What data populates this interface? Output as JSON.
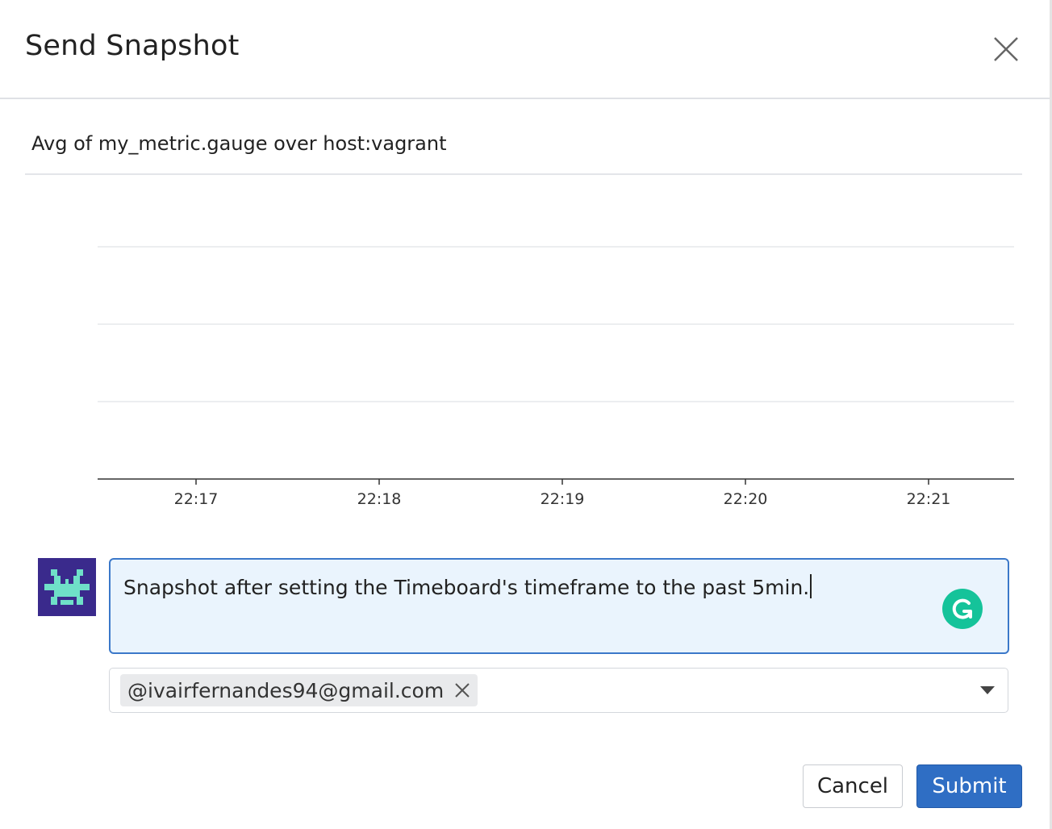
{
  "dialog": {
    "title": "Send Snapshot",
    "close_icon": "close-icon"
  },
  "graph": {
    "title": "Avg of my_metric.gauge over host:vagrant"
  },
  "chart_data": {
    "type": "line",
    "title": "Avg of my_metric.gauge over host:vagrant",
    "x_ticks": [
      "22:17",
      "22:18",
      "22:19",
      "22:20",
      "22:21"
    ],
    "series": [],
    "grid": true,
    "horizontal_gridlines": 3
  },
  "comment": {
    "text": "Snapshot after setting the Timeboard's timeframe to the past 5min.",
    "avatar_icon": "user-avatar-icon",
    "grammarly_icon": "grammarly-icon"
  },
  "recipients": {
    "items": [
      {
        "label": "@ivairfernandes94@gmail.com"
      }
    ],
    "dropdown_icon": "caret-down-icon"
  },
  "actions": {
    "cancel_label": "Cancel",
    "submit_label": "Submit"
  },
  "colors": {
    "primary": "#2f6ec4",
    "focus_border": "#3b78c9",
    "comment_bg": "#eaf4fd",
    "avatar_bg": "#3a2a8c",
    "avatar_glyph": "#6fe0c8",
    "grammarly": "#15c39a"
  }
}
